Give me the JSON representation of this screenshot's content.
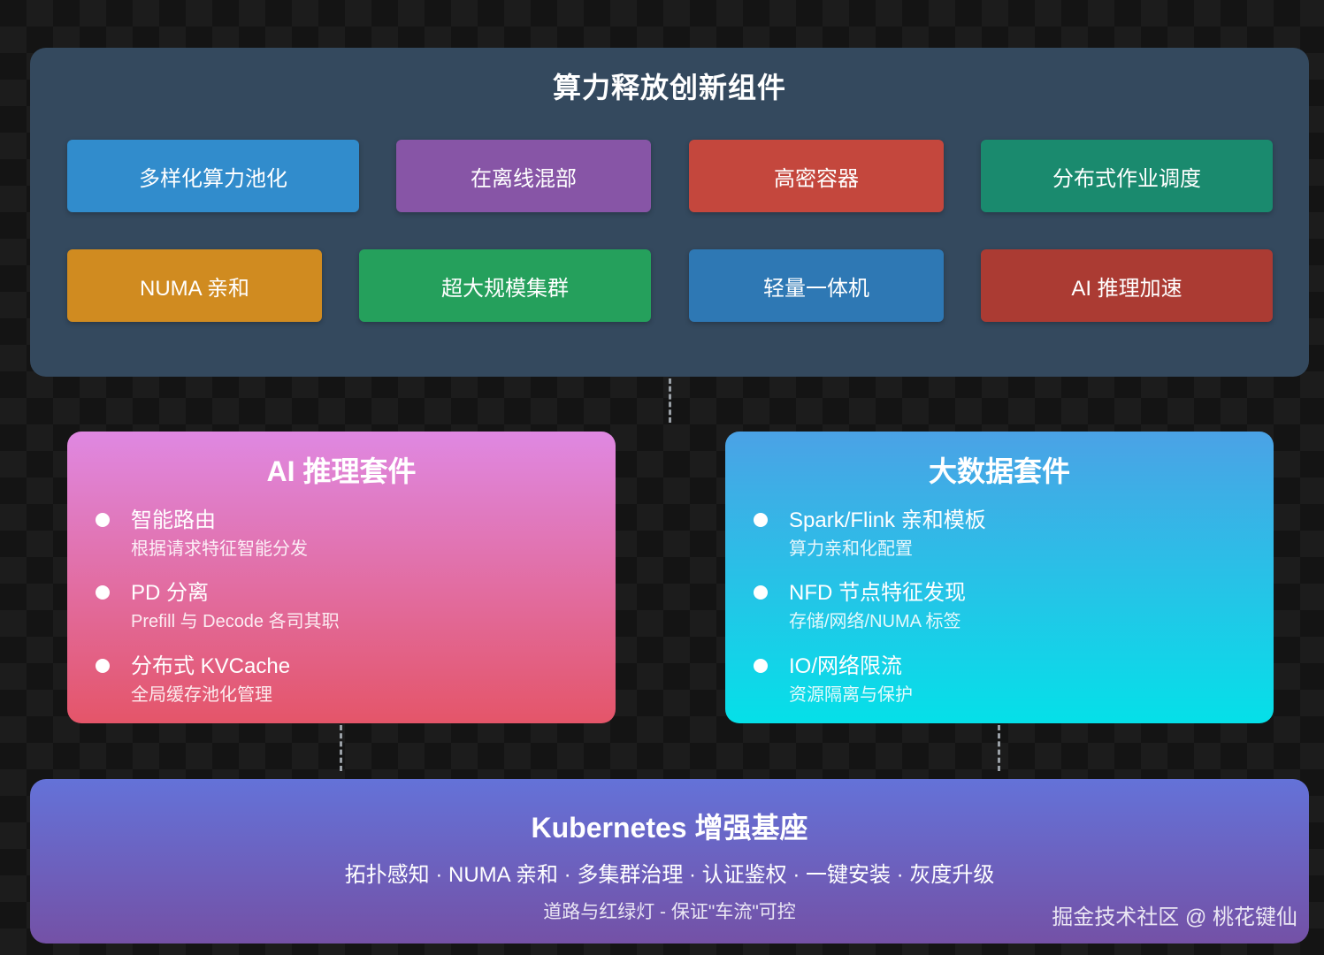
{
  "top_panel": {
    "title": "算力释放创新组件",
    "components": [
      {
        "label": "多样化算力池化",
        "color": "#318ccc"
      },
      {
        "label": "在离线混部",
        "color": "#8755a6"
      },
      {
        "label": "高密容器",
        "color": "#c4473d"
      },
      {
        "label": "分布式作业调度",
        "color": "#1a8a6e"
      },
      {
        "label": "NUMA 亲和",
        "color": "#d08b20"
      },
      {
        "label": "超大规模集群",
        "color": "#25a05c"
      },
      {
        "label": "轻量一体机",
        "color": "#2e78b4"
      },
      {
        "label": "AI 推理加速",
        "color": "#ab3b33"
      }
    ]
  },
  "ai_suite": {
    "title": "AI 推理套件",
    "items": [
      {
        "title": "智能路由",
        "sub": "根据请求特征智能分发"
      },
      {
        "title": "PD 分离",
        "sub": "Prefill 与 Decode 各司其职"
      },
      {
        "title": "分布式 KVCache",
        "sub": "全局缓存池化管理"
      }
    ]
  },
  "bigdata_suite": {
    "title": "大数据套件",
    "items": [
      {
        "title": "Spark/Flink 亲和模板",
        "sub": "算力亲和化配置"
      },
      {
        "title": "NFD 节点特征发现",
        "sub": "存储/网络/NUMA 标签"
      },
      {
        "title": "IO/网络限流",
        "sub": "资源隔离与保护"
      }
    ]
  },
  "base": {
    "title": "Kubernetes 增强基座",
    "features": "拓扑感知 · NUMA 亲和 · 多集群治理 · 认证鉴权 · 一键安装 · 灰度升级",
    "tagline": "道路与红绿灯 - 保证\"车流\"可控"
  },
  "watermark": "掘金技术社区 @ 桃花键仙"
}
